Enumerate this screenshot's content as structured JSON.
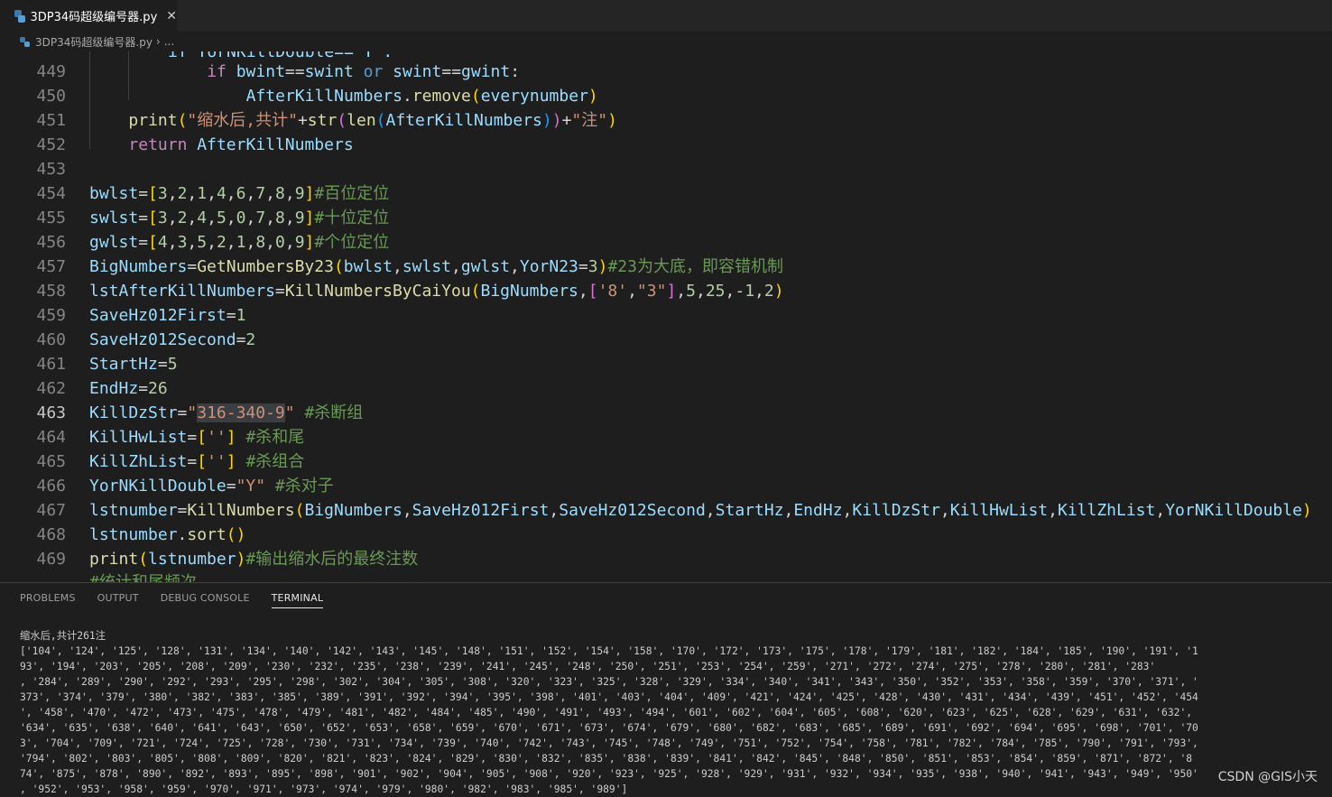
{
  "tab": {
    "title": "3DP34码超级编号器.py",
    "close_glyph": "✕"
  },
  "breadcrumb": {
    "file": "3DP34码超级编号器.py",
    "separator": "›",
    "more": "..."
  },
  "editor": {
    "active_line": "463",
    "lines": [
      {
        "n": "449",
        "text": "if bwint==swint or swint==gwint:"
      },
      {
        "n": "450",
        "text": "AfterKillNumbers.remove(everynumber)"
      },
      {
        "n": "451",
        "text": "print(\"缩水后,共计\"+str(len(AfterKillNumbers))+\"注\")"
      },
      {
        "n": "452",
        "text": "return AfterKillNumbers"
      },
      {
        "n": "453",
        "text": ""
      },
      {
        "n": "454",
        "text": "bwlst=[3,2,1,4,6,7,8,9]#百位定位"
      },
      {
        "n": "455",
        "text": "swlst=[3,2,4,5,0,7,8,9]#十位定位"
      },
      {
        "n": "456",
        "text": "gwlst=[4,3,5,2,1,8,0,9]#个位定位"
      },
      {
        "n": "457",
        "text": "BigNumbers=GetNumbersBy23(bwlst,swlst,gwlst,YorN23=3)#23为大底，即容错机制"
      },
      {
        "n": "458",
        "text": "lstAfterKillNumbers=KillNumbersByCaiYou(BigNumbers,['8',\"3\"],5,25,-1,2)"
      },
      {
        "n": "459",
        "text": "SaveHz012First=1"
      },
      {
        "n": "460",
        "text": "SaveHz012Second=2"
      },
      {
        "n": "461",
        "text": "StartHz=5"
      },
      {
        "n": "462",
        "text": "EndHz=26"
      },
      {
        "n": "463",
        "text": "KillDzStr=\"316-340-9\" #杀断组"
      },
      {
        "n": "464",
        "text": "KillHwList=[''] #杀和尾"
      },
      {
        "n": "465",
        "text": "KillZhList=[''] #杀组合"
      },
      {
        "n": "466",
        "text": "YorNKillDouble=\"Y\" #杀对子"
      },
      {
        "n": "467",
        "text": "lstnumber=KillNumbers(BigNumbers,SaveHz012First,SaveHz012Second,StartHz,EndHz,KillDzStr,KillHwList,KillZhList,YorNKillDouble)"
      },
      {
        "n": "468",
        "text": "lstnumber.sort()"
      },
      {
        "n": "469",
        "text": "print(lstnumber)#输出缩水后的最终注数"
      }
    ]
  },
  "panel": {
    "tabs": [
      "PROBLEMS",
      "OUTPUT",
      "DEBUG CONSOLE",
      "TERMINAL"
    ],
    "active_tab": "TERMINAL",
    "terminal_lines": [
      "缩水后,共计261注",
      "['104', '124', '125', '128', '131', '134', '140', '142', '143', '145', '148', '151', '152', '154', '158', '170', '172', '173', '175', '178', '179', '181', '182', '184', '185', '190', '191', '1",
      "93', '194', '203', '205', '208', '209', '230', '232', '235', '238', '239', '241', '245', '248', '250', '251', '253', '254', '259', '271', '272', '274', '275', '278', '280', '281', '283'",
      ", '284', '289', '290', '292', '293', '295', '298', '302', '304', '305', '308', '320', '323', '325', '328', '329', '334', '340', '341', '343', '350', '352', '353', '358', '359', '370', '371', '",
      "373', '374', '379', '380', '382', '383', '385', '389', '391', '392', '394', '395', '398', '401', '403', '404', '409', '421', '424', '425', '428', '430', '431', '434', '439', '451', '452', '454",
      "', '458', '470', '472', '473', '475', '478', '479', '481', '482', '484', '485', '490', '491', '493', '494', '601', '602', '604', '605', '608', '620', '623', '625', '628', '629', '631', '632',",
      "'634', '635', '638', '640', '641', '643', '650', '652', '653', '658', '659', '670', '671', '673', '674', '679', '680', '682', '683', '685', '689', '691', '692', '694', '695', '698', '701', '70",
      "3', '704', '709', '721', '724', '725', '728', '730', '731', '734', '739', '740', '742', '743', '745', '748', '749', '751', '752', '754', '758', '781', '782', '784', '785', '790', '791', '793',",
      "'794', '802', '803', '805', '808', '809', '820', '821', '823', '824', '829', '830', '832', '835', '838', '839', '841', '842', '845', '848', '850', '851', '853', '854', '859', '871', '872', '8",
      "74', '875', '878', '890', '892', '893', '895', '898', '901', '902', '904', '905', '908', '920', '923', '925', '928', '929', '931', '932', '934', '935', '938', '940', '941', '943', '949', '950'",
      ", '952', '953', '958', '959', '970', '971', '973', '974', '979', '980', '982', '983', '985', '989']"
    ]
  },
  "watermark": "CSDN @GIS小天",
  "colors": {
    "background": "#1e1e1e",
    "keyword": "#c586c0",
    "builtin": "#569cd6",
    "function": "#dcdcaa",
    "variable": "#9cdcfe",
    "number": "#b5cea8",
    "string": "#ce9178",
    "comment": "#6a9955"
  }
}
